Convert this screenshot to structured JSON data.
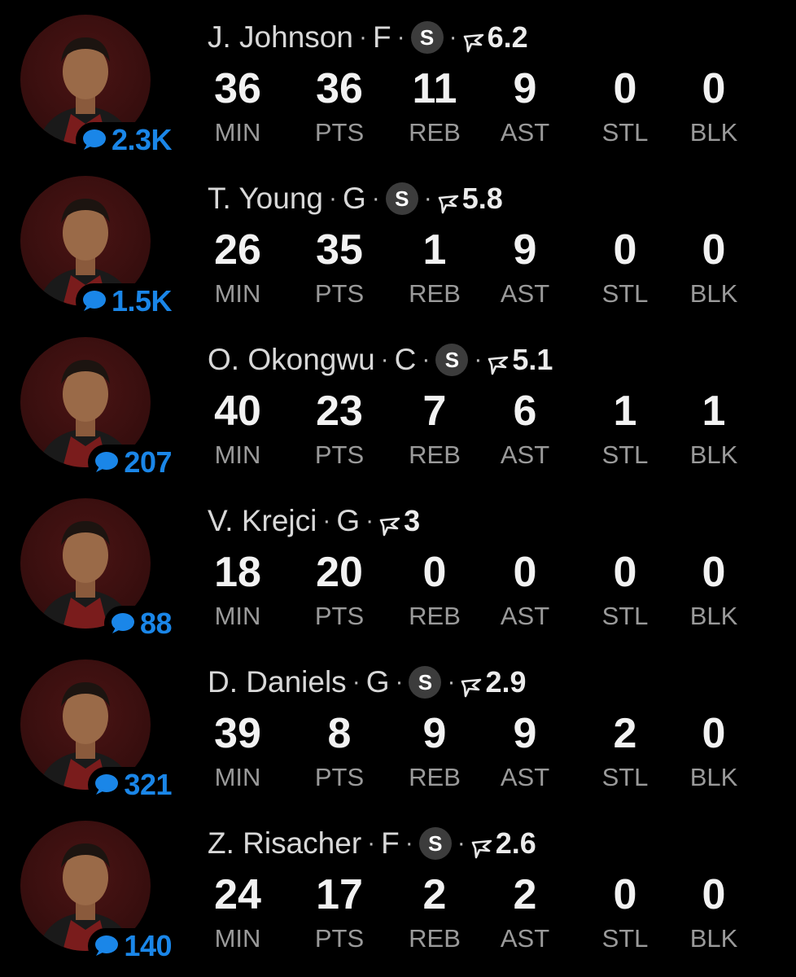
{
  "stat_labels": [
    "MIN",
    "PTS",
    "REB",
    "AST",
    "STL",
    "BLK"
  ],
  "colors": {
    "background": "#000000",
    "comment_blue": "#1a86e8",
    "stat_label_gray": "#9a9a9a",
    "starter_badge": "#3c3c3c",
    "avatar_bg": "#3a0f0f"
  },
  "players": [
    {
      "name": "J. Johnson",
      "position": "F",
      "starter": true,
      "starter_label": "S",
      "rating": "6.2",
      "comments": "2.3K",
      "stats": [
        "36",
        "36",
        "11",
        "9",
        "0",
        "0"
      ]
    },
    {
      "name": "T. Young",
      "position": "G",
      "starter": true,
      "starter_label": "S",
      "rating": "5.8",
      "comments": "1.5K",
      "stats": [
        "26",
        "35",
        "1",
        "9",
        "0",
        "0"
      ]
    },
    {
      "name": "O. Okongwu",
      "position": "C",
      "starter": true,
      "starter_label": "S",
      "rating": "5.1",
      "comments": "207",
      "stats": [
        "40",
        "23",
        "7",
        "6",
        "1",
        "1"
      ]
    },
    {
      "name": "V. Krejci",
      "position": "G",
      "starter": false,
      "starter_label": "",
      "rating": "3",
      "comments": "88",
      "stats": [
        "18",
        "20",
        "0",
        "0",
        "0",
        "0"
      ]
    },
    {
      "name": "D. Daniels",
      "position": "G",
      "starter": true,
      "starter_label": "S",
      "rating": "2.9",
      "comments": "321",
      "stats": [
        "39",
        "8",
        "9",
        "9",
        "2",
        "0"
      ]
    },
    {
      "name": "Z. Risacher",
      "position": "F",
      "starter": true,
      "starter_label": "S",
      "rating": "2.6",
      "comments": "140",
      "stats": [
        "24",
        "17",
        "2",
        "2",
        "0",
        "0"
      ]
    }
  ]
}
